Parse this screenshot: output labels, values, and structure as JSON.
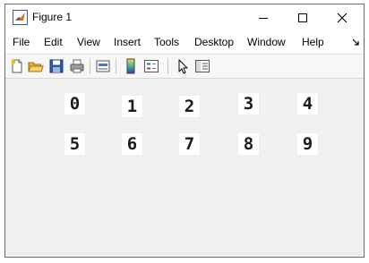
{
  "window": {
    "title": "Figure 1"
  },
  "menu": [
    "File",
    "Edit",
    "View",
    "Insert",
    "Tools",
    "Desktop",
    "Window",
    "Help"
  ],
  "toolbar": {
    "icons": [
      "new-file-icon",
      "open-folder-icon",
      "save-icon",
      "print-icon",
      "link-plot-icon",
      "colorbar-icon",
      "legend-icon",
      "pointer-icon",
      "property-inspector-icon"
    ]
  },
  "figure": {
    "digits_row1": [
      "0",
      "1",
      "2",
      "3",
      "4"
    ],
    "digits_row2": [
      "5",
      "6",
      "7",
      "8",
      "9"
    ]
  },
  "colors": {
    "canvas": "#f0f0f0",
    "matlab_orange": "#e06a1b"
  }
}
